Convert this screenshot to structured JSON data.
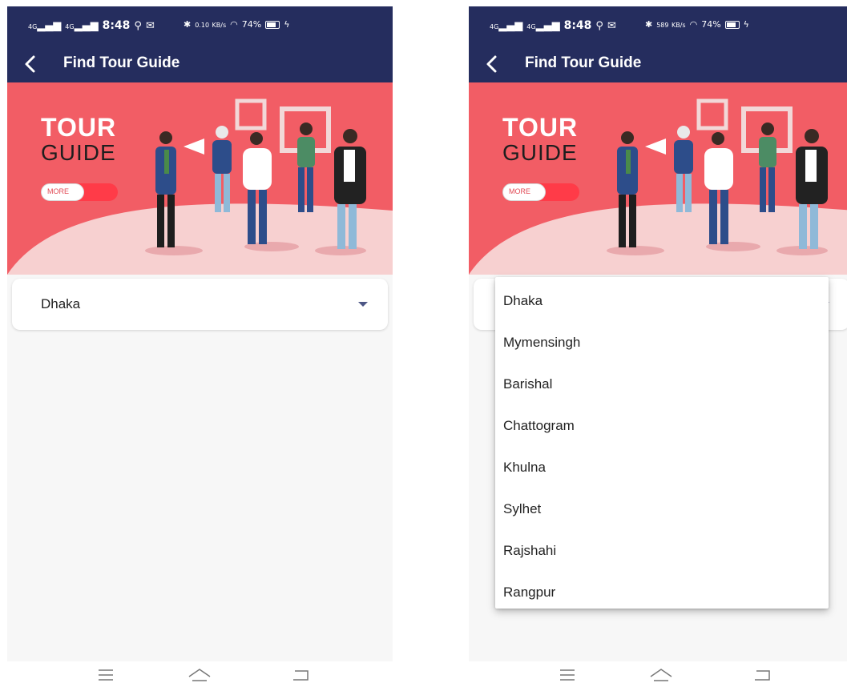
{
  "status": {
    "net1": "4G",
    "net2": "4G",
    "time": "8:48",
    "speed_left": "0.10",
    "speed_left_unit": "KB/s",
    "speed_right": "589",
    "speed_right_unit": "KB/s",
    "battery": "74%"
  },
  "appbar": {
    "title": "Find Tour Guide"
  },
  "banner": {
    "tour": "TOUR",
    "guide": "GUIDE",
    "more": "MORE"
  },
  "dropdown": {
    "selected": "Dhaka"
  },
  "menu": {
    "options": [
      "Dhaka",
      "Mymensingh",
      "Barishal",
      "Chattogram",
      "Khulna",
      "Sylhet",
      "Rajshahi",
      "Rangpur"
    ]
  },
  "colors": {
    "appbar": "#252d5e",
    "banner": "#f25d65",
    "toggle": "#ff3b48"
  }
}
